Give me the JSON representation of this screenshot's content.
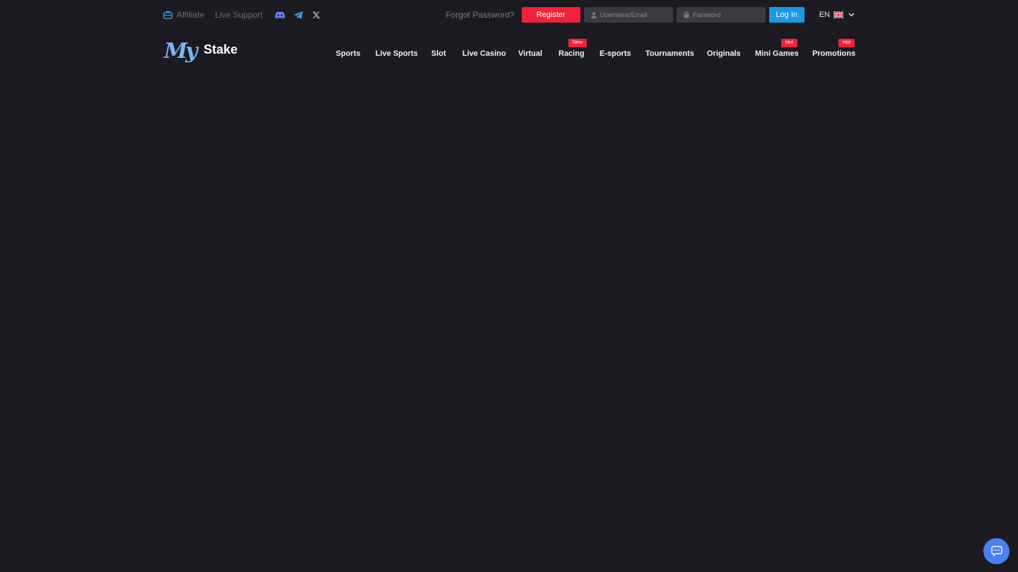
{
  "topbar": {
    "affiliate_label": "Affiliate",
    "live_support_label": "Live Support",
    "forgot_password_label": "Forgot Password?",
    "register_label": "Register",
    "username_placeholder": "Username/Email",
    "password_placeholder": "Password",
    "login_label": "Log In",
    "language": "EN"
  },
  "logo": {
    "my": "My",
    "stake": "Stake"
  },
  "nav": {
    "items": [
      {
        "label": "Sports"
      },
      {
        "label": "Live Sports"
      },
      {
        "label": "Slot"
      },
      {
        "label": "Live Casino"
      },
      {
        "label": "Virtual"
      },
      {
        "label": "Racing",
        "badge": "New"
      },
      {
        "label": "E-sports"
      },
      {
        "label": "Tournaments"
      },
      {
        "label": "Originals"
      },
      {
        "label": "Mini Games",
        "badge": "Hot"
      },
      {
        "label": "Promotions",
        "badge": "Hot"
      }
    ]
  },
  "colors": {
    "background": "#1b1b21",
    "register": "#f0233b",
    "login": "#1a9ae6",
    "badge": "#f0233b",
    "logo_my": "#7fb6ee",
    "chat_fab": "#4a80ef"
  },
  "icons": {
    "affiliate": "briefcase-icon",
    "discord": "discord-icon",
    "telegram": "telegram-icon",
    "x": "x-twitter-icon",
    "user": "user-icon",
    "lock": "lock-icon",
    "flag": "uk-flag-icon",
    "chevron": "chevron-down-icon",
    "chat": "chat-icon"
  }
}
